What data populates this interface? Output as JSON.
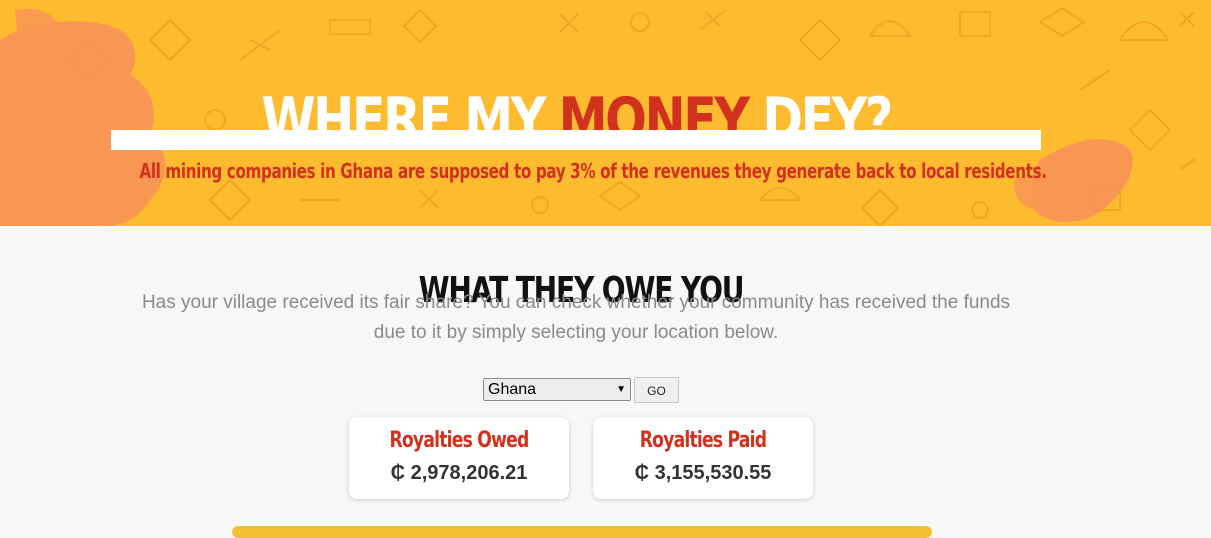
{
  "hero": {
    "title_part1": "WHERE MY ",
    "title_accent": "MONEY",
    "title_part2": " DEY?",
    "subtitle": "All mining companies in Ghana are supposed to pay 3% of the revenues they generate back to local residents."
  },
  "section": {
    "title": "WHAT THEY OWE YOU",
    "intro": "Has your village received its fair share? You can check whether your community has received the funds due to it by simply selecting your location below."
  },
  "location": {
    "selected": "Ghana",
    "go_label": "GO"
  },
  "cards": {
    "owed_label": "Royalties Owed",
    "owed_value": "₵ 2,978,206.21",
    "paid_label": "Royalties Paid",
    "paid_value": "₵ 3,155,530.55"
  },
  "colors": {
    "banner": "#fdbb30",
    "accent": "#d1321e",
    "fist": "#f7915a"
  },
  "icons": [
    "fist-icon",
    "mining-pattern-icon",
    "chevron-down-icon"
  ]
}
